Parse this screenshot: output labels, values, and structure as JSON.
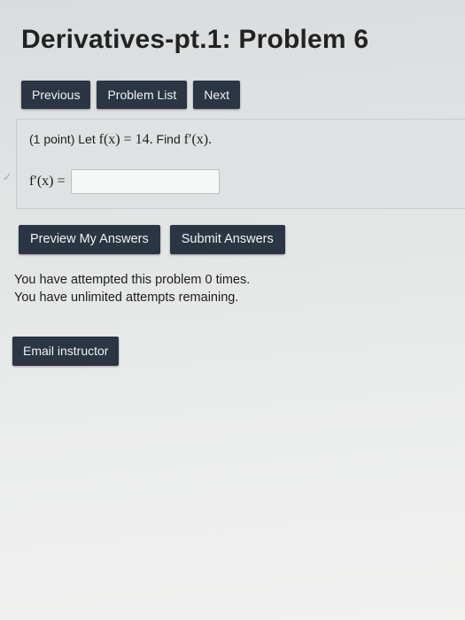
{
  "page": {
    "title": "Derivatives-pt.1: Problem 6"
  },
  "nav": {
    "previous_label": "Previous",
    "problem_list_label": "Problem List",
    "next_label": "Next"
  },
  "problem": {
    "points": "(1 point)",
    "statement_prefix": "Let",
    "function_def": "f(x) = 14.",
    "find_prefix": "Find",
    "find_target": "f′(x).",
    "answer_label": "f′(x) =",
    "answer_value": "",
    "check_icon": "checkmark-icon"
  },
  "actions": {
    "preview_label": "Preview My Answers",
    "submit_label": "Submit Answers"
  },
  "status": {
    "attempts_line": "You have attempted this problem 0 times.",
    "remaining_line": "You have unlimited attempts remaining."
  },
  "footer": {
    "email_label": "Email instructor"
  },
  "colors": {
    "button_bg": "#2b3544",
    "button_text": "#f2f2f2",
    "background": "#e4e6e6"
  }
}
